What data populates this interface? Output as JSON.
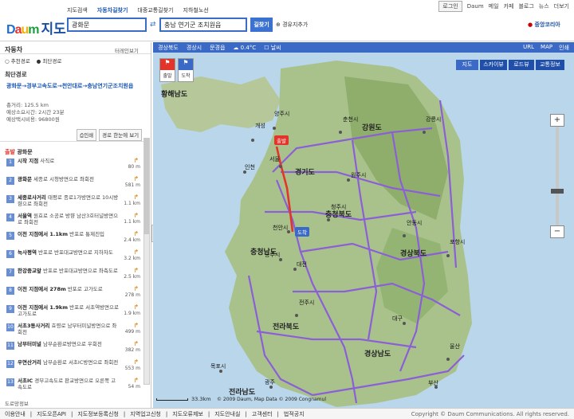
{
  "brand": {
    "logo": "Daum",
    "title": "지도"
  },
  "services": [
    "지도검색",
    "자동차길찾기",
    "대중교통길찾기",
    "지하철노선"
  ],
  "util": [
    "로그인",
    "Daum",
    "메일",
    "카페",
    "블로그",
    "뉴스",
    "더보기"
  ],
  "search": {
    "from": "광화문",
    "to": "충남 연기군 조치원읍",
    "button": "길찾기",
    "waypoint": "경유지추가",
    "region": "중앙코리아"
  },
  "sidebar": {
    "mode": "자동차",
    "terrain": "터레인보기",
    "options": [
      "추천경로",
      "최단경로"
    ],
    "section": "최단경로",
    "route": "광화문→경부고속도로→천안대로→충남연기군조치원읍",
    "distance": "총거리: 125.5 km",
    "time": "예상소요시간: 2시간 23분",
    "fare": "예상택시비용: 96800원",
    "buttons": [
      "인쇄",
      "경로 한눈에 보기"
    ],
    "start_tag": "출발",
    "start_name": "광화문",
    "steps": [
      {
        "n": "1",
        "name": "시작 지점",
        "desc": "사직로",
        "dist": "80 m"
      },
      {
        "n": "2",
        "name": "광화문",
        "desc": "세종로 시청방면으로 좌회전",
        "dist": "581 m"
      },
      {
        "n": "3",
        "name": "세종로사거리",
        "desc": "태평로 종로1가방면으로 10시방향으로 좌회전",
        "dist": "1.1 km"
      },
      {
        "n": "4",
        "name": "서울역",
        "desc": "원효로 소공로 방향 남산3호터널방면으로 좌회전",
        "dist": "1.1 km"
      },
      {
        "n": "5",
        "name": "이전 지점에서 1.1km",
        "desc": "반포로 통제진입",
        "dist": "2.4 km"
      },
      {
        "n": "6",
        "name": "녹사평역",
        "desc": "반포로 반포대교방면으로 지하차도",
        "dist": "3.2 km"
      },
      {
        "n": "7",
        "name": "한강중교앞",
        "desc": "반포로 반포대교방면으로 좌측도로",
        "dist": "2.5 km"
      },
      {
        "n": "8",
        "name": "이전 지점에서 278m",
        "desc": "반포로 고가도로",
        "dist": "278 m"
      },
      {
        "n": "9",
        "name": "이전 지점에서 1.9km",
        "desc": "반포로 서초역방면으로 고가도로",
        "dist": "1.9 km"
      },
      {
        "n": "10",
        "name": "서초3동사거리",
        "desc": "효령로 남부터미널방면으로 좌회전",
        "dist": "499 m"
      },
      {
        "n": "11",
        "name": "남부터미널",
        "desc": "남부순환로방면으로 우회전",
        "dist": "382 m"
      },
      {
        "n": "12",
        "name": "우면산거리",
        "desc": "남부순환로 서초IC방면으로 좌회전",
        "dist": "553 m"
      },
      {
        "n": "13",
        "name": "서초IC",
        "desc": "경부고속도로 판교방면으로 오른쪽 고속도로",
        "dist": "54 m"
      }
    ],
    "bottom": "도로망정보"
  },
  "mapbar": {
    "items": [
      "경상북도",
      "경상시",
      "문경읍",
      "0.4°C",
      "날씨"
    ],
    "right": [
      "URL",
      "MAP",
      "인쇄"
    ]
  },
  "maptabs": [
    "지도",
    "스카이뷰",
    "로드뷰",
    "교통정보"
  ],
  "map": {
    "start_label": "출발",
    "end_label": "도착",
    "scale": "33.3km",
    "copyright": "© 2009 Daum, Map Data © 2009 Congnamul",
    "regions": [
      "황해남도",
      "강원도",
      "경기도",
      "충청북도",
      "충청남도",
      "경상북도",
      "전라북도",
      "경상남도",
      "전라남도"
    ],
    "cities": [
      "개성",
      "양주시",
      "춘천시",
      "인천",
      "서울",
      "원주시",
      "대전",
      "대구",
      "광주",
      "울산",
      "부산",
      "안동시",
      "포항시",
      "전주시",
      "청주시",
      "천안시",
      "공주시",
      "강릉시",
      "목포시"
    ]
  },
  "footer": {
    "items": [
      "이용안내",
      "지도오픈API",
      "지도정보등록신청",
      "지역업고신청",
      "지도오류제보",
      "지도안내실",
      "고객센터",
      "법적공지"
    ],
    "copy": "Copyright © Daum Communications. All rights reserved."
  }
}
